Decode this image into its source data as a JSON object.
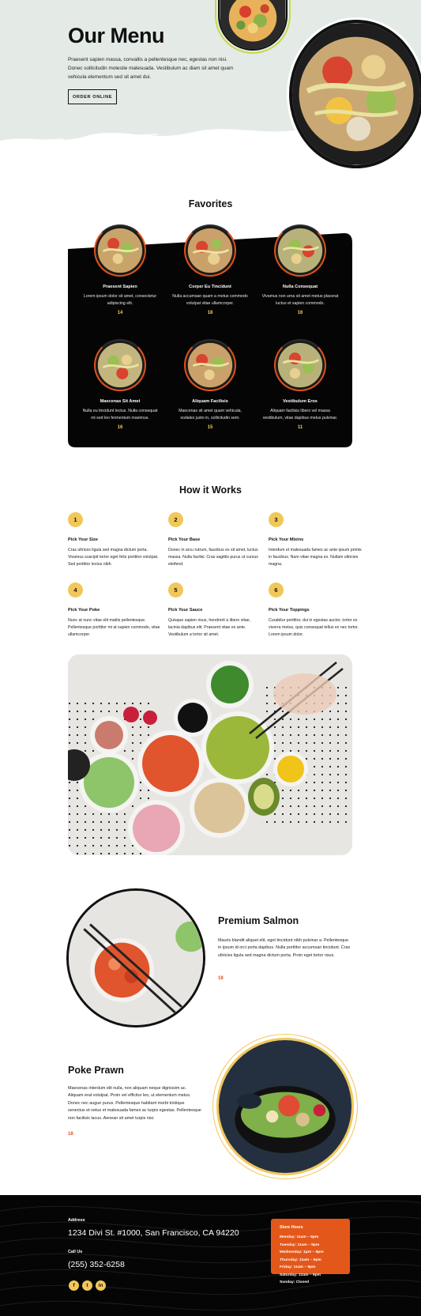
{
  "hero": {
    "title": "Our Menu",
    "text": "Praesent sapien massa, convallis a pellentesque nec, egestas non nisi. Donec sollicitudin molestie malesuada. Vestibulum ac diam sit amet quam vehicula elementum sed sit amet dui.",
    "button": "ORDER ONLINE"
  },
  "favorites": {
    "title": "Favorites",
    "items": [
      {
        "name": "Praesent Sapien",
        "desc": "Lorem ipsum dolor sit amet, consectetur adipiscing elit.",
        "price": "14"
      },
      {
        "name": "Corper Eu Tincidunt",
        "desc": "Nulla accumsan quam a metus commodo volutpat vitae ullamcorper.",
        "price": "18"
      },
      {
        "name": "Nulla Consequat",
        "desc": "Vivamus non urna sit amet metus placerat luctus et sapien commodo.",
        "price": "16"
      },
      {
        "name": "Maecenas Sit Amet",
        "desc": "Nulla eu tincidunt lectus. Nulla consequat mi sed leo fermentum maximus.",
        "price": "16"
      },
      {
        "name": "Aliquam Facilisis",
        "desc": "Maecenas sit amet quam vehicula, sodales justo in, sollicitudin sem.",
        "price": "15"
      },
      {
        "name": "Vestibulum Eros",
        "desc": "Aliquam facilisis libero vel massa vestibulum, vitae dapibus metus pulvinar.",
        "price": "11"
      }
    ]
  },
  "how": {
    "title": "How it Works",
    "steps": [
      {
        "num": "1",
        "title": "Pick Your Size",
        "desc": "Cras ultrices ligula sed magna dictum porta. Vivamus suscipit tortor eget felis porttitor volutpat. Sed porttitor lectus nibh."
      },
      {
        "num": "2",
        "title": "Pick Your Base",
        "desc": "Donec in arcu rutrum, faucibus ex sit amet, luctus massa. Nulla facilisi. Cras sagittis purus ut cursus eleifend."
      },
      {
        "num": "3",
        "title": "Pick Your Mixins",
        "desc": "Interdum et malesuada fames ac ante ipsum primis in faucibus. Nam vitae magna ex. Nullam ultricies magna."
      },
      {
        "num": "4",
        "title": "Pick Your Poke",
        "desc": "Nunc at nunc vitae elit mattis pellentesque. Pellentesque porttitor mi at sapien commodo, vitae ullamcorper."
      },
      {
        "num": "5",
        "title": "Pick Your Sauce",
        "desc": "Quisque sapien risus, hendrerit a libero vitae, lacinia dapibus elit. Praesent vitae ex ante. Vestibulum a tortor sit amet."
      },
      {
        "num": "6",
        "title": "Pick Your Toppings",
        "desc": "Curabitur porttitor, dui in egestas auctor, tortor ex viverra metus, quis consequat tellus ex nec tortor. Lorem ipsum dolor."
      }
    ]
  },
  "salmon": {
    "title": "Premium Salmon",
    "desc": "Mauris blandit aliquet elit, eget tincidunt nibh pulvinar a. Pellentesque in ipsum id orci porta dapibus. Nulla porttitor accumsan tincidunt. Cras ultricies ligula sed magna dictum porta. Proin eget tortor risus.",
    "price": "18"
  },
  "prawn": {
    "title": "Poke Prawn",
    "desc": "Maecenas interdum elit nulla, non aliquam neque dignissim ac. Aliquam erat volutpat. Proin vel efficitur leo, ut elementum metus. Donec nec augue purus. Pellentesque habitant morbi tristique senectus et netus et malesuada fames ac turpis egestas. Pellentesque non facilisis lacus. Aenean sit amet turpis nisi.",
    "price": "18"
  },
  "footer": {
    "address_label": "Address",
    "address": "1234 Divi St. #1000, San Francisco, CA 94220",
    "call_label": "Call Us",
    "phone": "(255) 352-6258",
    "social": [
      "f",
      "t",
      "in"
    ],
    "hours_title": "Store Hours",
    "hours": [
      "Monday: 11am – 9pm",
      "Tuesday: 11am – 9pm",
      "Wednesday: 1pm – 9pm",
      "Thursday: 11am – 9pm",
      "Friday: 11am – 9pm",
      "Saturday: 12am – 9pm",
      "Sunday: Closed"
    ]
  },
  "colors": {
    "accent_orange": "#e0531a",
    "accent_yellow": "#f1c75a",
    "hero_bg": "#e4ebe7",
    "dark": "#050505"
  }
}
